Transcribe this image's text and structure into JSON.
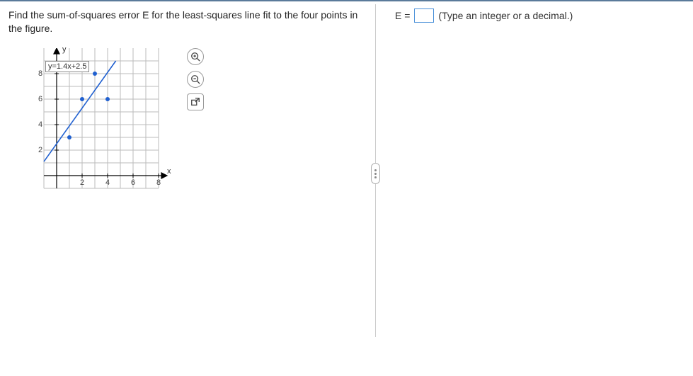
{
  "question": {
    "text": "Find the sum-of-squares error E for the least-squares line fit to the four points in the figure."
  },
  "figure": {
    "equation": "y=1.4x+2.5",
    "y_axis_label": "y",
    "x_axis_label": "x",
    "y_ticks": [
      "2",
      "4",
      "6",
      "8"
    ],
    "x_ticks": [
      "2",
      "4",
      "6",
      "8"
    ]
  },
  "chart_data": {
    "type": "scatter",
    "title": "",
    "xlabel": "x",
    "ylabel": "y",
    "xlim": [
      -1,
      9
    ],
    "ylim": [
      -1,
      9
    ],
    "series": [
      {
        "name": "points",
        "x": [
          1,
          2,
          3,
          4
        ],
        "y": [
          3,
          6,
          8,
          6
        ]
      },
      {
        "name": "line",
        "equation": "y = 1.4x + 2.5",
        "slope": 1.4,
        "intercept": 2.5
      }
    ]
  },
  "tools": {
    "zoom_in": "zoom-in",
    "zoom_out": "zoom-out",
    "popout": "popout"
  },
  "answer": {
    "prefix": "E =",
    "value": "",
    "hint": "(Type an integer or a decimal.)"
  }
}
